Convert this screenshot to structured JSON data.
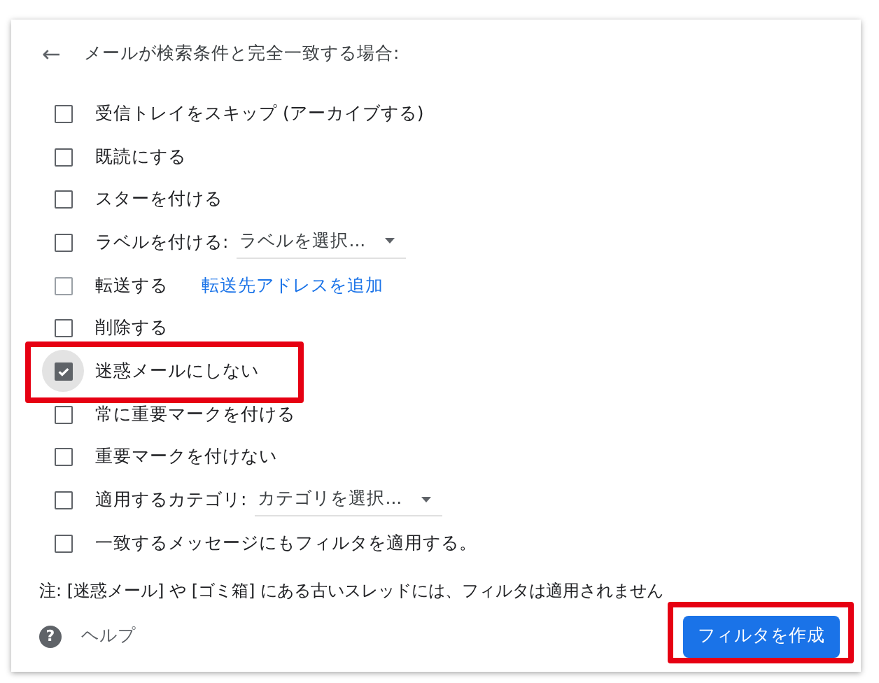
{
  "header": {
    "back": "←",
    "title": "メールが検索条件と完全一致する場合:"
  },
  "options": [
    {
      "kind": "plain",
      "label": "受信トレイをスキップ (アーカイブする)",
      "checked": false,
      "disabled": false,
      "highlighted": false
    },
    {
      "kind": "plain",
      "label": "既読にする",
      "checked": false,
      "disabled": false,
      "highlighted": false
    },
    {
      "kind": "plain",
      "label": "スターを付ける",
      "checked": false,
      "disabled": false,
      "highlighted": false
    },
    {
      "kind": "select",
      "label": "ラベルを付ける:",
      "select": "ラベルを選択...",
      "checked": false,
      "disabled": false,
      "highlighted": false
    },
    {
      "kind": "link",
      "label": "転送する",
      "link": "転送先アドレスを追加",
      "checked": false,
      "disabled": true,
      "highlighted": false
    },
    {
      "kind": "plain",
      "label": "削除する",
      "checked": false,
      "disabled": false,
      "highlighted": false
    },
    {
      "kind": "plain",
      "label": "迷惑メールにしない",
      "checked": true,
      "disabled": false,
      "highlighted": true
    },
    {
      "kind": "plain",
      "label": "常に重要マークを付ける",
      "checked": false,
      "disabled": false,
      "highlighted": false
    },
    {
      "kind": "plain",
      "label": "重要マークを付けない",
      "checked": false,
      "disabled": false,
      "highlighted": false
    },
    {
      "kind": "select",
      "label": "適用するカテゴリ:",
      "select": "カテゴリを選択...",
      "checked": false,
      "disabled": false,
      "highlighted": false
    },
    {
      "kind": "plain",
      "label": "一致するメッセージにもフィルタを適用する。",
      "checked": false,
      "disabled": false,
      "highlighted": false
    }
  ],
  "note": "注: [迷惑メール] や [ゴミ箱] にある古いスレッドには、フィルタは適用されません",
  "help": {
    "icon": "?",
    "label": "ヘルプ"
  },
  "create_button": {
    "label": "フィルタを作成",
    "highlighted": true
  }
}
